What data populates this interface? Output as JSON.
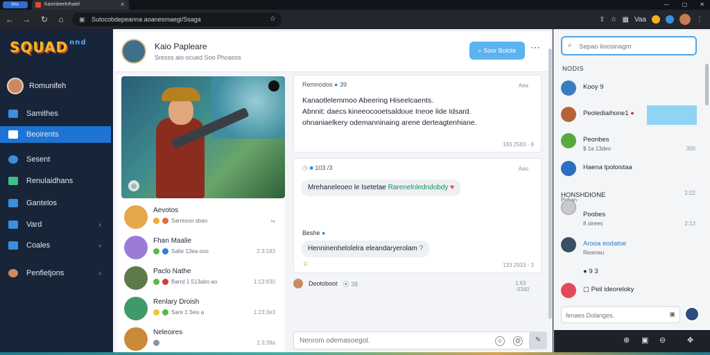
{
  "browser": {
    "tab0_label": "Srte",
    "tab_label": "Kasmbeehrhatel",
    "url": "Sutocobdepeanna aoanesmaegi/Ssaga",
    "window_controls": [
      "—",
      "▢",
      "✕"
    ],
    "right_label": "Vaa"
  },
  "sidebar": {
    "logo": "SQUAD",
    "logo_sub": "nnd",
    "user_name": "Romunifeh",
    "items": [
      {
        "label": "Samithes",
        "icon": "users-icon"
      },
      {
        "label": "Beoirents",
        "icon": "home-icon",
        "active": true
      },
      {
        "label": "Sesent",
        "icon": "globe-icon"
      },
      {
        "label": "Renulaidhans",
        "icon": "chart-icon"
      },
      {
        "label": "Gantelos",
        "icon": "grid-icon"
      },
      {
        "label": "Vard",
        "icon": "calendar-icon",
        "chevron": true
      },
      {
        "label": "Coales",
        "icon": "folder-icon",
        "chevron": true
      },
      {
        "label": "Penfietjons",
        "icon": "person-icon",
        "chevron": true
      }
    ]
  },
  "chat": {
    "title": "Kaio Papleare",
    "subtitle": "Sresss aio ocued Soo Phoasss",
    "action_label": "Soor Bolote"
  },
  "members": [
    {
      "name": "Aevotos",
      "meta": "Sarresoo sbao"
    },
    {
      "name": "Fhan Maalie",
      "meta": "Salte 13ea ooo",
      "right": "2:3:183"
    },
    {
      "name": "Paclo Nathe",
      "meta": "Barrd 1 513abo ao",
      "right": "1:13:830"
    },
    {
      "name": "Renlary Droish",
      "meta": "Sare 1 3eis a",
      "right": "1:23:3e3"
    },
    {
      "name": "Neleoires",
      "meta": "",
      "right": "1:3:39a"
    }
  ],
  "messages": {
    "m1_from": "Remnodos",
    "m1_from_num": "39",
    "m1_time": "Aea",
    "m1_lines": [
      "Kanaotlelemmoo Abeering Hiseelcaents.",
      "Abnnit: daecs kineeocooetsaldoue Ineoe lide Idsard.",
      "ohnaniaelkery odemanninaing arene derteagtenhiane."
    ],
    "m1_foot": "183 2583 - 8",
    "m2_from": "103 /3",
    "m2_time": "Aao",
    "m2_bubble_pre": "Mrehaneleoeo le Isetetae ",
    "m2_bubble_hl": "Rarenelnledndobdy",
    "m3_name": "Beshe",
    "m3_bubble": "Henninenhelolelra eleandaryerolam",
    "m3_foot": "133 2933 - 3",
    "sys_text": "Deotoboot",
    "sys_num": "38",
    "sys_time": "1:63 -3340"
  },
  "composer": {
    "placeholder": "Nenrom odemasoegot."
  },
  "rightpanel": {
    "search_placeholder": "Sepao lioosinagm",
    "section_title": "NODIS",
    "items": [
      {
        "name": "Kooy 9",
        "sub": ""
      },
      {
        "name": "Peolediaihone1",
        "sub": ""
      },
      {
        "name": "Peonbes",
        "sub": "$ 1a 13deo",
        "right": "300"
      },
      {
        "name": "Haena lpoloistaa",
        "sub": ""
      },
      {
        "name": "HONSHDIONE",
        "sub": "Pohan",
        "right": "2:22"
      },
      {
        "name": "Poobes",
        "sub": "8 oirees",
        "right": "2:13"
      },
      {
        "name": "Arooa eodatoe",
        "sub": "Reomeu",
        "right": ""
      },
      {
        "name": "9 3",
        "sub": ""
      },
      {
        "name": "Peil ideoreloky",
        "sub": ""
      }
    ],
    "composer_placeholder": "fenaes Dolanges."
  },
  "colors": {
    "accent": "#1e74d4",
    "action": "#5bb3f0",
    "highlight": "#8fd3f5"
  }
}
